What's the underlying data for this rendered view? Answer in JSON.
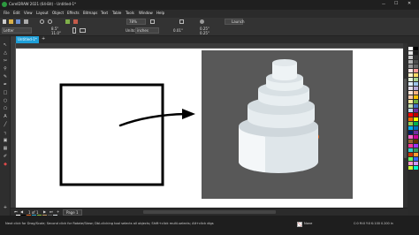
{
  "titlebar": {
    "title": "CorelDRAW 2021 (64-Bit) - Untitled-1*",
    "minimize_glyph": "—",
    "maximize_glyph": "☐",
    "close_glyph": "✕"
  },
  "menu": {
    "items": [
      "File",
      "Edit",
      "View",
      "Layout",
      "Object",
      "Effects",
      "Bitmaps",
      "Text",
      "Table",
      "Tools",
      "Window",
      "Help"
    ]
  },
  "standard_bar": {
    "zoom_value": "78%",
    "launch_label": "Launch"
  },
  "property_bar": {
    "paper_label": "Letter",
    "width_value": "8.5\"",
    "height_value": "11.0\"",
    "units_label": "Units:",
    "units_value": "inches",
    "nudge_value": "0.01\"",
    "dup_x": "0.25\"",
    "dup_y": "0.25\""
  },
  "document_tab": {
    "label": "Untitled-1*",
    "add_glyph": "+"
  },
  "page_nav": {
    "page_counter": "1 of 1",
    "page_tab": "Page 1"
  },
  "status": {
    "hint": "Next click for Drag/Scale; Second click for Rotate/Skew; Dbl-clicking tool selects all objects; Shift+click multi-selects; Alt+click digs",
    "color_info": "C:0 M:0 Y:0 K:100  0.200 in",
    "fill_label": "None"
  },
  "colors": {
    "accent": "#1e9fd8",
    "cake_orange": "#e0641e",
    "cake_blue": "#2aa7cf",
    "cake_green": "#8cbf3f",
    "cake_tan": "#c69a63",
    "image_bg": "#585858"
  },
  "icons": [
    "corel-logo-icon",
    "pick-tool-icon",
    "shape-tool-icon",
    "crop-tool-icon",
    "zoom-tool-icon",
    "freehand-tool-icon",
    "rectangle-tool-icon",
    "ellipse-tool-icon",
    "polygon-tool-icon",
    "text-tool-icon",
    "parallel-dimension-icon",
    "connector-icon",
    "drop-shadow-icon",
    "transparency-icon",
    "eyedropper-icon",
    "fill-tool-icon"
  ]
}
